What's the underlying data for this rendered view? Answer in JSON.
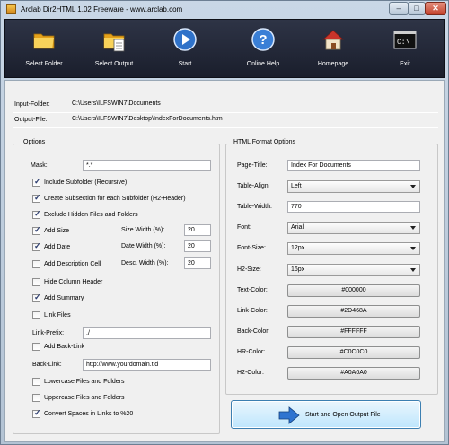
{
  "window": {
    "title": "Arclab Dir2HTML 1.02 Freeware - www.arclab.com",
    "min_glyph": "–",
    "max_glyph": "□",
    "close_glyph": "✕"
  },
  "toolbar": {
    "select_folder": "Select Folder",
    "select_output": "Select Output",
    "start": "Start",
    "online_help": "Online Help",
    "homepage": "Homepage",
    "exit": "Exit"
  },
  "paths": {
    "input_label": "Input-Folder:",
    "input_value": "C:\\Users\\ILFSWIN7\\Documents",
    "output_label": "Output-File:",
    "output_value": "C:\\Users\\ILFSWIN7\\Desktop\\IndexForDocuments.htm"
  },
  "options": {
    "title": "Options",
    "mask_label": "Mask:",
    "mask_value": "*.*",
    "include_subfolder": {
      "label": "Include Subfolder (Recursive)",
      "checked": true
    },
    "create_subsection": {
      "label": "Create Subsection for each Subfolder (H2-Header)",
      "checked": true
    },
    "exclude_hidden": {
      "label": "Exclude Hidden Files and Folders",
      "checked": true
    },
    "add_size": {
      "label": "Add Size",
      "checked": true
    },
    "add_date": {
      "label": "Add Date",
      "checked": true
    },
    "add_description": {
      "label": "Add Description Cell",
      "checked": false
    },
    "hide_column_header": {
      "label": "Hide Column Header",
      "checked": false
    },
    "add_summary": {
      "label": "Add Summary",
      "checked": true
    },
    "link_files": {
      "label": "Link Files",
      "checked": false
    },
    "size_width_label": "Size Width (%):",
    "size_width_value": "20",
    "date_width_label": "Date Width (%):",
    "date_width_value": "20",
    "desc_width_label": "Desc. Width (%):",
    "desc_width_value": "20",
    "link_prefix_label": "Link-Prefix:",
    "link_prefix_value": "./",
    "add_back_link": {
      "label": "Add Back-Link",
      "checked": false
    },
    "back_link_label": "Back-Link:",
    "back_link_value": "http://www.yourdomain.tld",
    "lowercase": {
      "label": "Lowercase Files and Folders",
      "checked": false
    },
    "uppercase": {
      "label": "Uppercase Files and Folders",
      "checked": false
    },
    "convert_spaces": {
      "label": "Convert Spaces in Links to %20",
      "checked": true
    }
  },
  "html_format": {
    "title": "HTML Format Options",
    "page_title_label": "Page-Title:",
    "page_title_value": "Index For Documents",
    "table_align_label": "Table-Align:",
    "table_align_value": "Left",
    "table_width_label": "Table-Width:",
    "table_width_value": "770",
    "font_label": "Font:",
    "font_value": "Arial",
    "font_size_label": "Font-Size:",
    "font_size_value": "12px",
    "h2_size_label": "H2-Size:",
    "h2_size_value": "16px",
    "text_color_label": "Text-Color:",
    "text_color_value": "#000000",
    "link_color_label": "Link-Color:",
    "link_color_value": "#2D468A",
    "back_color_label": "Back-Color:",
    "back_color_value": "#FFFFFF",
    "hr_color_label": "HR-Color:",
    "hr_color_value": "#C0C0C0",
    "h2_color_label": "H2-Color:",
    "h2_color_value": "#A0A0A0"
  },
  "start_button": {
    "label": "Start and Open Output File"
  }
}
